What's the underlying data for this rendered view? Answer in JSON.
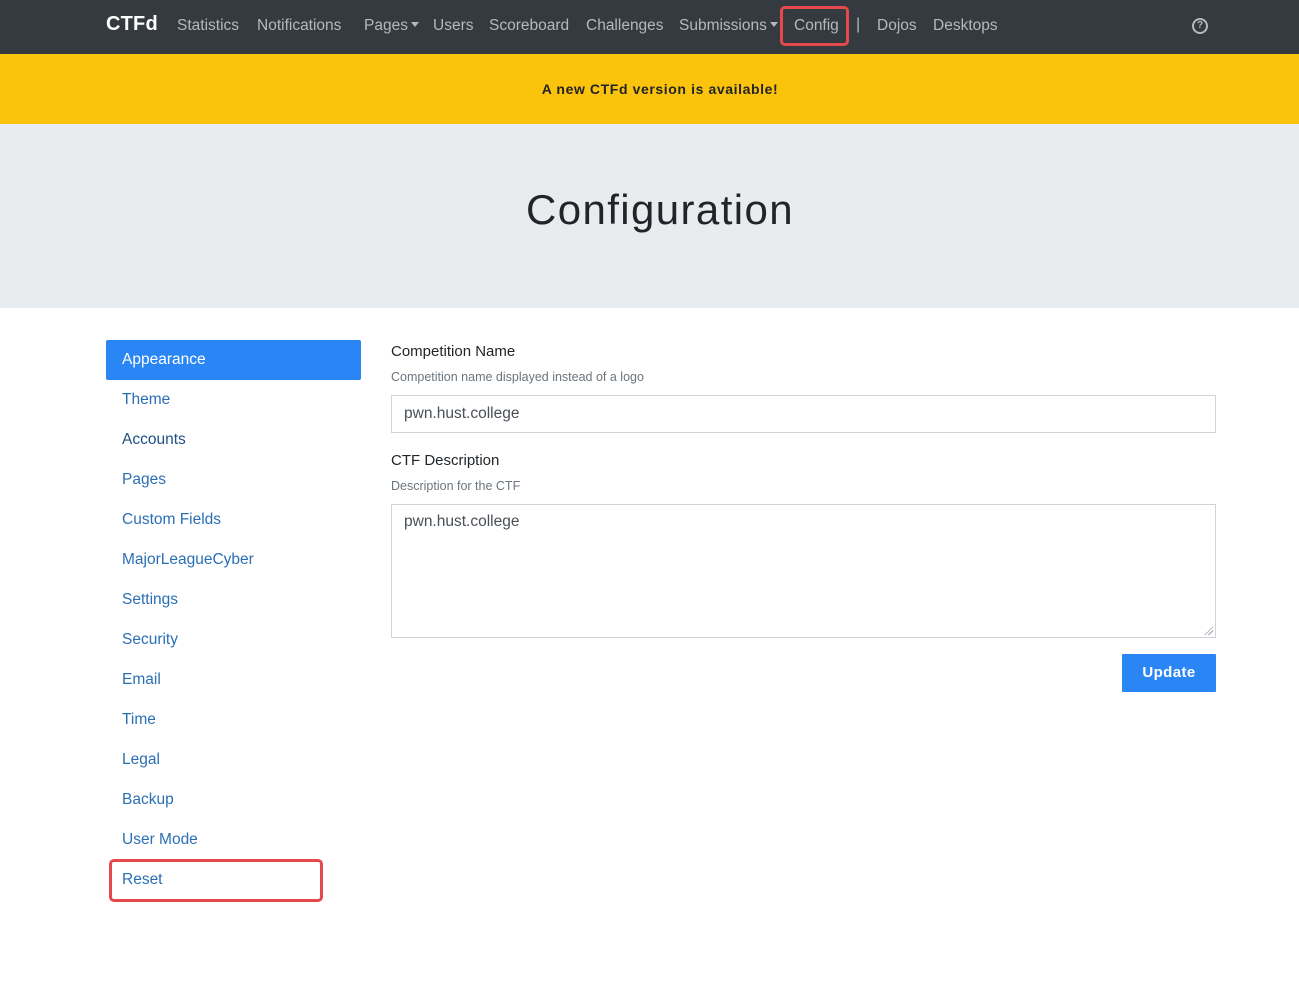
{
  "navbar": {
    "brand": "CTFd",
    "items": [
      {
        "label": "Statistics"
      },
      {
        "label": "Notifications"
      },
      {
        "label": "Pages",
        "dropdown": true
      },
      {
        "label": "Users"
      },
      {
        "label": "Scoreboard"
      },
      {
        "label": "Challenges"
      },
      {
        "label": "Submissions",
        "dropdown": true
      },
      {
        "label": "Config",
        "highlighted": true
      },
      {
        "label": "Dojos"
      },
      {
        "label": "Desktops"
      }
    ],
    "separator": "|",
    "help_icon": "question-circle-icon",
    "help_glyph": "?"
  },
  "alert": {
    "text": "A new CTFd version is available!",
    "color": "#fbc30b"
  },
  "page": {
    "title": "Configuration"
  },
  "sidebar": {
    "items": [
      {
        "label": "Appearance",
        "active": true
      },
      {
        "label": "Theme"
      },
      {
        "label": "Accounts"
      },
      {
        "label": "Pages"
      },
      {
        "label": "Custom Fields"
      },
      {
        "label": "MajorLeagueCyber"
      },
      {
        "label": "Settings"
      },
      {
        "label": "Security"
      },
      {
        "label": "Email"
      },
      {
        "label": "Time"
      },
      {
        "label": "Legal"
      },
      {
        "label": "Backup"
      },
      {
        "label": "User Mode"
      },
      {
        "label": "Reset",
        "highlighted": true
      }
    ]
  },
  "form": {
    "competition_name": {
      "label": "Competition Name",
      "help": "Competition name displayed instead of a logo",
      "value": "pwn.hust.college"
    },
    "ctf_description": {
      "label": "CTF Description",
      "help": "Description for the CTF",
      "value": "pwn.hust.college"
    },
    "submit_label": "Update"
  },
  "colors": {
    "navbar_bg": "#343a40",
    "accent": "#2b86f5",
    "highlight_box": "#e5484d",
    "jumbotron_bg": "#e9ecef"
  }
}
